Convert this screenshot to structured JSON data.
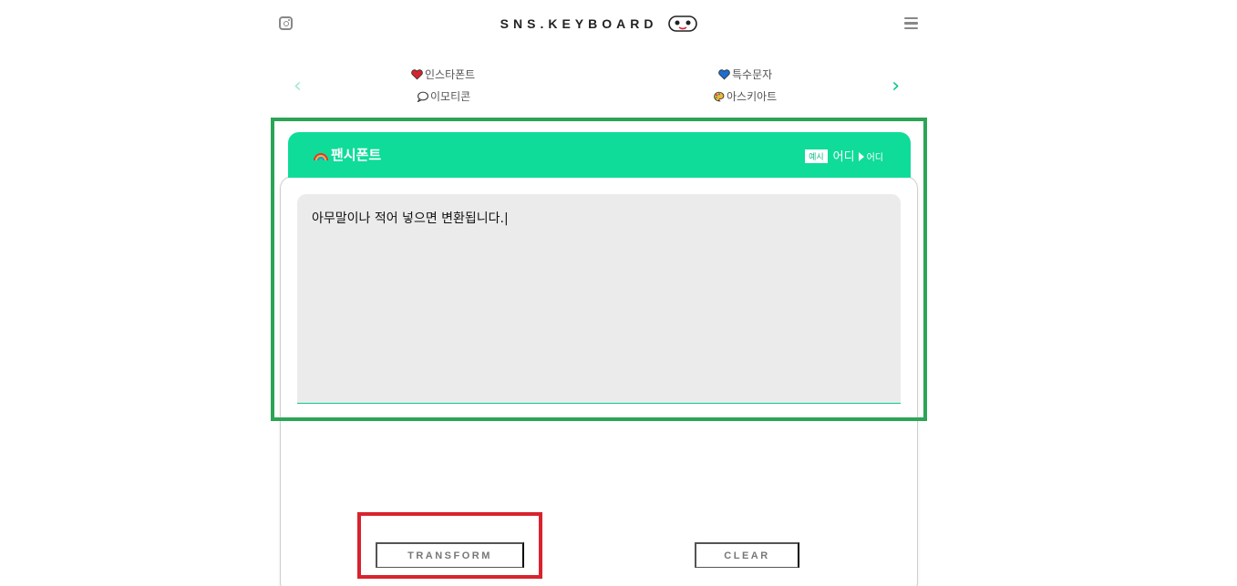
{
  "header": {
    "logo_text": "SNS.KEYBOARD",
    "instagram_icon": "instagram-icon",
    "menu_icon": "hamburger-menu-icon"
  },
  "categories": [
    {
      "label": "인스타폰트",
      "icon": "red-heart-icon"
    },
    {
      "label": "이모티콘",
      "icon": "speech-bubble-icon"
    },
    {
      "label": "특수문자",
      "icon": "blue-heart-icon"
    },
    {
      "label": "아스키아트",
      "icon": "palette-icon"
    }
  ],
  "card": {
    "title": "팬시폰트",
    "example_badge": "예시",
    "example_from": "어디",
    "example_to": "어디",
    "input_value": "아무말이나 적어 넣으면 변환됩니다.|"
  },
  "actions": {
    "transform_label": "TRANSFORM",
    "clear_label": "CLEAR"
  },
  "colors": {
    "accent": "#0fdc98",
    "highlight_green": "#2ba555",
    "highlight_red": "#d8232e"
  }
}
